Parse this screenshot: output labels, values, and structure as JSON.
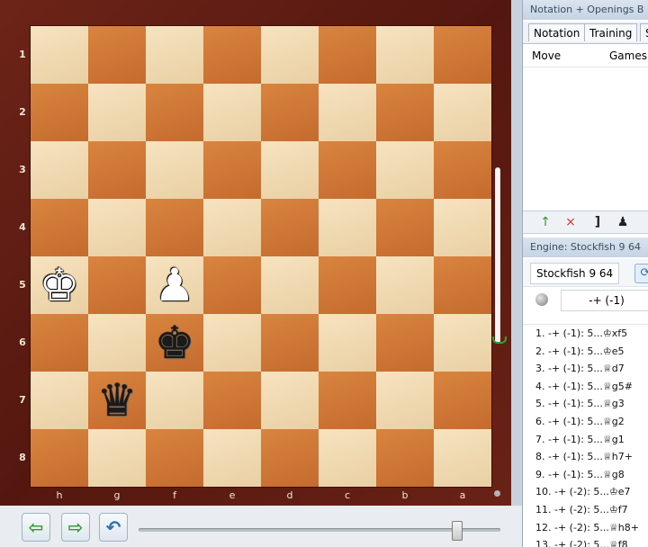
{
  "board": {
    "rank_labels": [
      "1",
      "2",
      "3",
      "4",
      "5",
      "6",
      "7",
      "8"
    ],
    "file_labels": [
      "h",
      "g",
      "f",
      "e",
      "d",
      "c",
      "b",
      "a"
    ],
    "pieces": [
      {
        "row": 4,
        "col": 0,
        "glyph": "♚",
        "color": "white",
        "name": "white-king"
      },
      {
        "row": 4,
        "col": 2,
        "glyph": "♟",
        "color": "white",
        "name": "white-pawn"
      },
      {
        "row": 5,
        "col": 2,
        "glyph": "♚",
        "color": "black",
        "name": "black-king"
      },
      {
        "row": 6,
        "col": 1,
        "glyph": "♛",
        "color": "black",
        "name": "black-queen"
      }
    ]
  },
  "toolbar": {
    "back_icon": "arrow-left-icon",
    "forward_icon": "arrow-right-icon",
    "undo_icon": "undo-icon",
    "back_glyph": "⇦",
    "forward_glyph": "⇨",
    "undo_glyph": "↶"
  },
  "notation_panel": {
    "title": "Notation + Openings B",
    "tabs": [
      "Notation",
      "Training",
      "S"
    ],
    "columns": {
      "move": "Move",
      "games": "Games"
    }
  },
  "engine_panel": {
    "title": "Engine: Stockfish 9 64",
    "engine_name": "Stockfish 9 64",
    "evaluation": "-+ (-1)",
    "lines": [
      "1.  -+ (-1): 5...♔xf5",
      "2.  -+ (-1): 5...♔e5",
      "3.  -+ (-1): 5...♕d7",
      "4.  -+ (-1): 5...♕g5#",
      "5.  -+ (-1): 5...♕g3",
      "6.  -+ (-1): 5...♕g2",
      "7.  -+ (-1): 5...♕g1",
      "8.  -+ (-1): 5...♕h7+",
      "9.  -+ (-1): 5...♕g8",
      "10.  -+ (-2): 5...♔e7",
      "11.  -+ (-2): 5...♔f7",
      "12.  -+ (-2): 5...♕h8+",
      "13.  -+ (-2): 5...♕f8"
    ]
  }
}
